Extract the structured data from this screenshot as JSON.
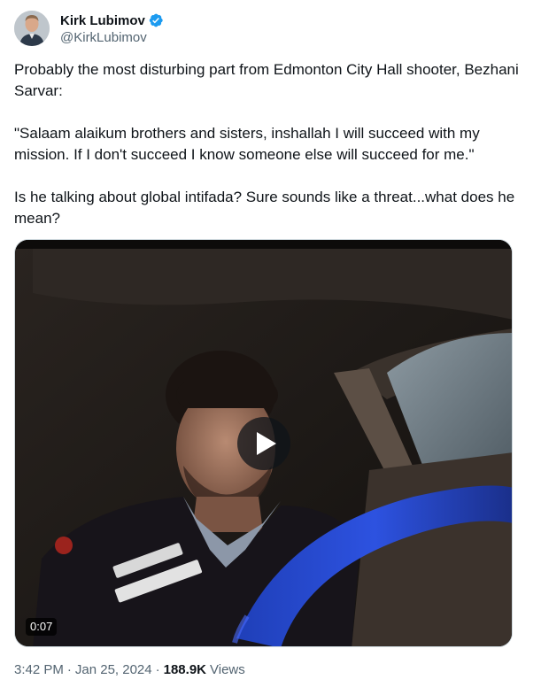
{
  "author": {
    "display_name": "Kirk Lubimov",
    "handle": "@KirkLubimov",
    "verified": true
  },
  "tweet": {
    "paragraphs": [
      "Probably the most disturbing part from Edmonton City Hall shooter, Bezhani Sarvar:",
      "\"Salaam alaikum brothers and sisters, inshallah I will succeed with my mission. If I don't succeed I know someone else will succeed for me.\"",
      "Is he talking about global intifada? Sure sounds like a threat...what does he mean?"
    ]
  },
  "media": {
    "type": "video",
    "duration": "0:07"
  },
  "meta": {
    "time": "3:42 PM",
    "separator": "·",
    "date": "Jan 25, 2024",
    "views_count": "188.9K",
    "views_label": "Views"
  },
  "colors": {
    "text_primary": "#0f1419",
    "text_secondary": "#536471",
    "verified_blue": "#1d9bf0",
    "border": "#cfd9de"
  }
}
